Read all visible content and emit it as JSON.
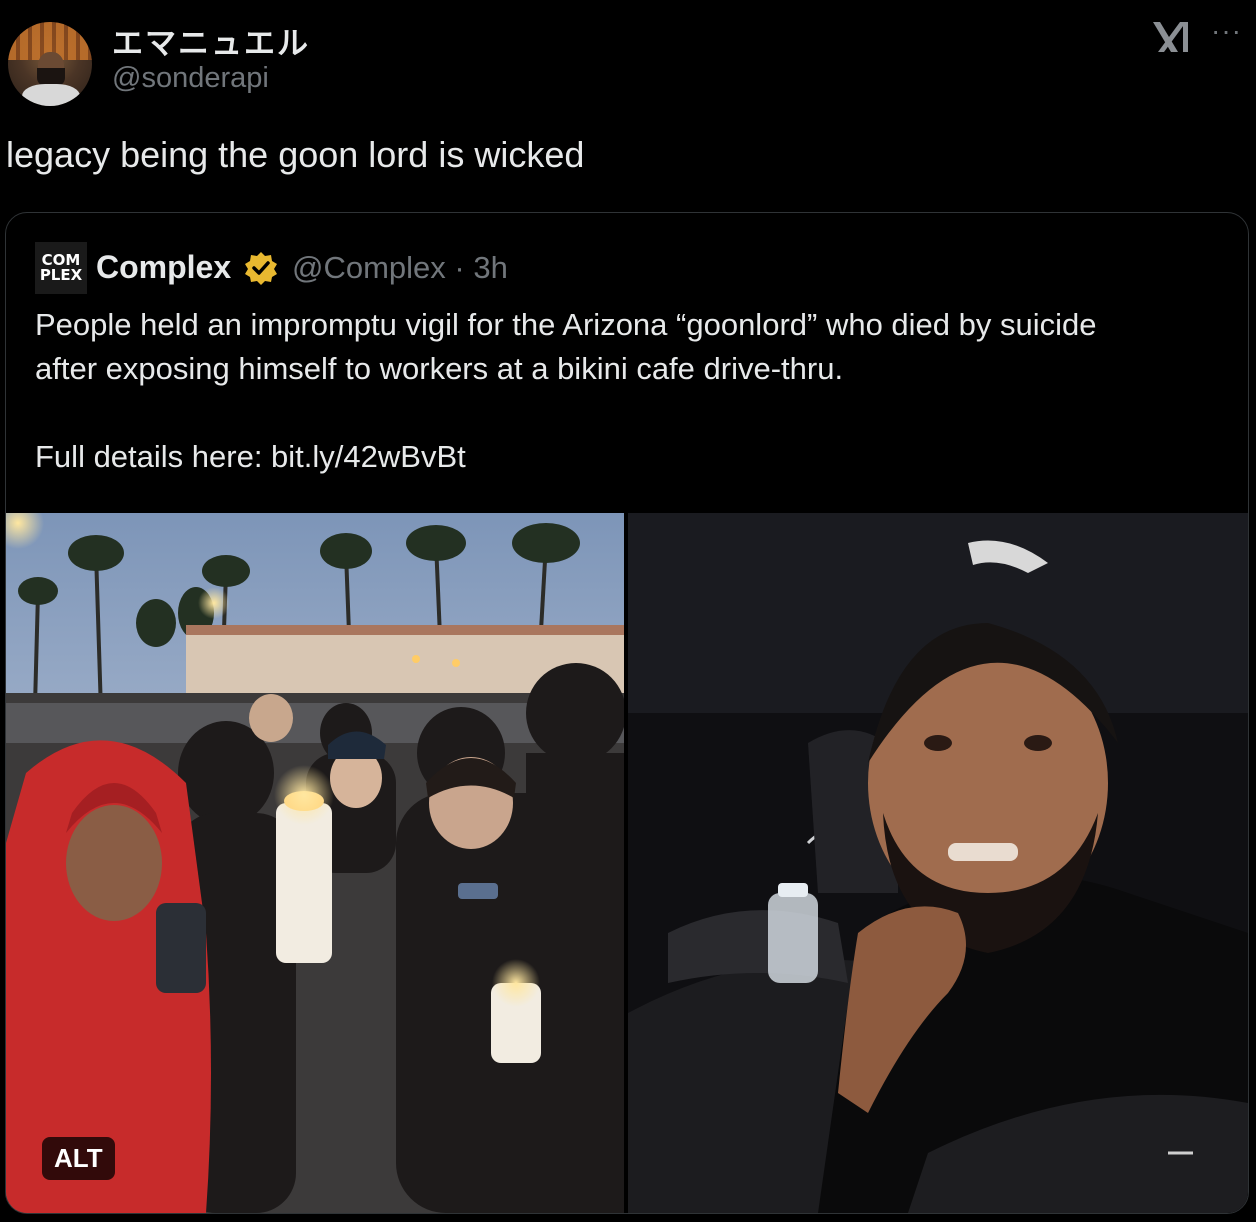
{
  "author": {
    "display_name": "エマニュエル",
    "handle": "@sonderapi",
    "avatar_icon": "user-avatar"
  },
  "header_icons": {
    "platform_logo": "xai-logo-icon",
    "more": "more-options-icon",
    "more_glyph": "···"
  },
  "tweet": {
    "text": "legacy being the goon lord is wicked"
  },
  "quote": {
    "logo_text_top": "COM",
    "logo_text_bottom": "PLEX",
    "name": "Complex",
    "verified_icon": "verified-gold-badge-icon",
    "handle": "@Complex",
    "separator": "·",
    "time": "3h",
    "body_line1": "People held an impromptu vigil for the Arizona “goonlord” who died by suicide",
    "body_line2": "after exposing himself to workers at a bikini cafe drive-thru.",
    "body_line3": "Full details here: bit.ly/42wBvBt",
    "media": {
      "left_image": "vigil-crowd-photo",
      "right_image": "man-in-car-photo",
      "alt_label": "ALT"
    }
  },
  "colors": {
    "background": "#000000",
    "text_primary": "#e7e9ea",
    "text_secondary": "#71767b",
    "border": "#2f3336",
    "verified_gold": "#e8b830"
  }
}
